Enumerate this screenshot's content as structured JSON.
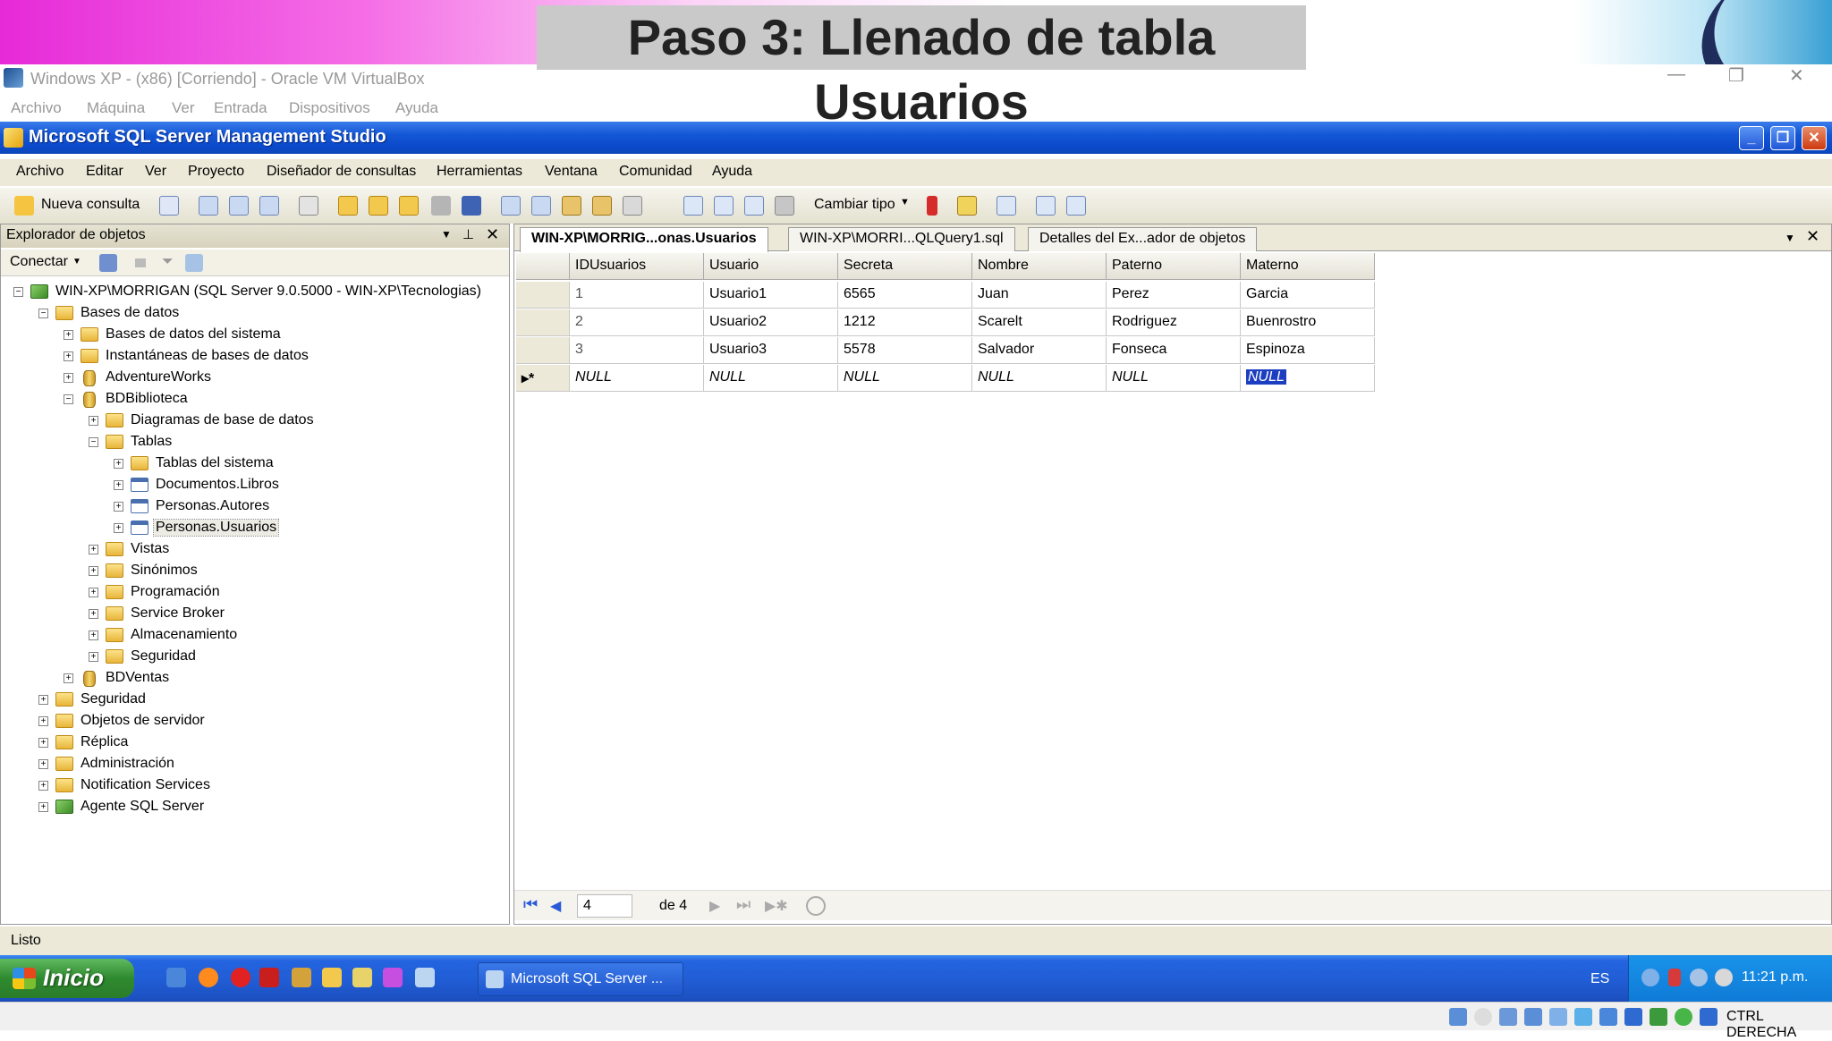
{
  "banner": {
    "title": "Paso 3: Llenado de tabla Usuarios"
  },
  "virtualbox": {
    "title": "Windows XP - (x86) [Corriendo] - Oracle VM VirtualBox",
    "menu": [
      "Archivo",
      "Máquina",
      "Ver",
      "Entrada",
      "Dispositivos",
      "Ayuda"
    ],
    "controls": {
      "minimize": "—",
      "restore": "❐",
      "close": "✕"
    },
    "status_host_key": "CTRL DERECHA"
  },
  "ssms": {
    "title": "Microsoft SQL Server Management Studio",
    "menu": [
      "Archivo",
      "Editar",
      "Ver",
      "Proyecto",
      "Diseñador de consultas",
      "Herramientas",
      "Ventana",
      "Comunidad",
      "Ayuda"
    ],
    "toolbar": {
      "new_query": "Nueva consulta",
      "change_type": "Cambiar tipo"
    },
    "status": "Listo"
  },
  "object_explorer": {
    "title": "Explorador de objetos",
    "connect": "Conectar",
    "tree": [
      {
        "label": "WIN-XP\\MORRIGAN (SQL Server 9.0.5000 - WIN-XP\\Tecnologias)",
        "icon": "server-icon",
        "state": "−"
      },
      {
        "label": "Bases de datos",
        "icon": "folder-icon",
        "state": "−"
      },
      {
        "label": "Bases de datos del sistema",
        "icon": "folder-icon",
        "state": "+"
      },
      {
        "label": "Instantáneas de bases de datos",
        "icon": "folder-icon",
        "state": "+"
      },
      {
        "label": "AdventureWorks",
        "icon": "database-icon",
        "state": "+"
      },
      {
        "label": "BDBiblioteca",
        "icon": "database-icon",
        "state": "−"
      },
      {
        "label": "Diagramas de base de datos",
        "icon": "folder-icon",
        "state": "+"
      },
      {
        "label": "Tablas",
        "icon": "folder-icon",
        "state": "−"
      },
      {
        "label": "Tablas del sistema",
        "icon": "folder-icon",
        "state": "+"
      },
      {
        "label": "Documentos.Libros",
        "icon": "table-icon",
        "state": "+"
      },
      {
        "label": "Personas.Autores",
        "icon": "table-icon",
        "state": "+"
      },
      {
        "label": "Personas.Usuarios",
        "icon": "table-icon",
        "state": "+"
      },
      {
        "label": "Vistas",
        "icon": "folder-icon",
        "state": "+"
      },
      {
        "label": "Sinónimos",
        "icon": "folder-icon",
        "state": "+"
      },
      {
        "label": "Programación",
        "icon": "folder-icon",
        "state": "+"
      },
      {
        "label": "Service Broker",
        "icon": "folder-icon",
        "state": "+"
      },
      {
        "label": "Almacenamiento",
        "icon": "folder-icon",
        "state": "+"
      },
      {
        "label": "Seguridad",
        "icon": "folder-icon",
        "state": "+"
      },
      {
        "label": "BDVentas",
        "icon": "database-icon",
        "state": "+"
      },
      {
        "label": "Seguridad",
        "icon": "folder-icon",
        "state": "+"
      },
      {
        "label": "Objetos de servidor",
        "icon": "folder-icon",
        "state": "+"
      },
      {
        "label": "Réplica",
        "icon": "folder-icon",
        "state": "+"
      },
      {
        "label": "Administración",
        "icon": "folder-icon",
        "state": "+"
      },
      {
        "label": "Notification Services",
        "icon": "folder-icon",
        "state": "+"
      },
      {
        "label": "Agente SQL Server",
        "icon": "agent-icon",
        "state": "+"
      }
    ]
  },
  "document": {
    "tabs": [
      "WIN-XP\\MORRIG...onas.Usuarios",
      "WIN-XP\\MORRI...QLQuery1.sql",
      "Detalles del Ex...ador de objetos"
    ],
    "grid": {
      "columns": [
        "IDUsuarios",
        "Usuario",
        "Secreta",
        "Nombre",
        "Paterno",
        "Materno"
      ],
      "rows": [
        [
          "1",
          "Usuario1",
          "6565",
          "Juan",
          "Perez",
          "Garcia"
        ],
        [
          "2",
          "Usuario2",
          "1212",
          "Scarelt",
          "Rodriguez",
          "Buenrostro"
        ],
        [
          "3",
          "Usuario3",
          "5578",
          "Salvador",
          "Fonseca",
          "Espinoza"
        ]
      ],
      "new_row": [
        "NULL",
        "NULL",
        "NULL",
        "NULL",
        "NULL",
        "NULL"
      ],
      "new_row_marker": "▸*"
    },
    "nav": {
      "current": "4",
      "of_label": "de 4"
    }
  },
  "taskbar": {
    "start": "Inicio",
    "task": "Microsoft SQL Server ...",
    "language": "ES",
    "clock": "11:21 p.m."
  }
}
